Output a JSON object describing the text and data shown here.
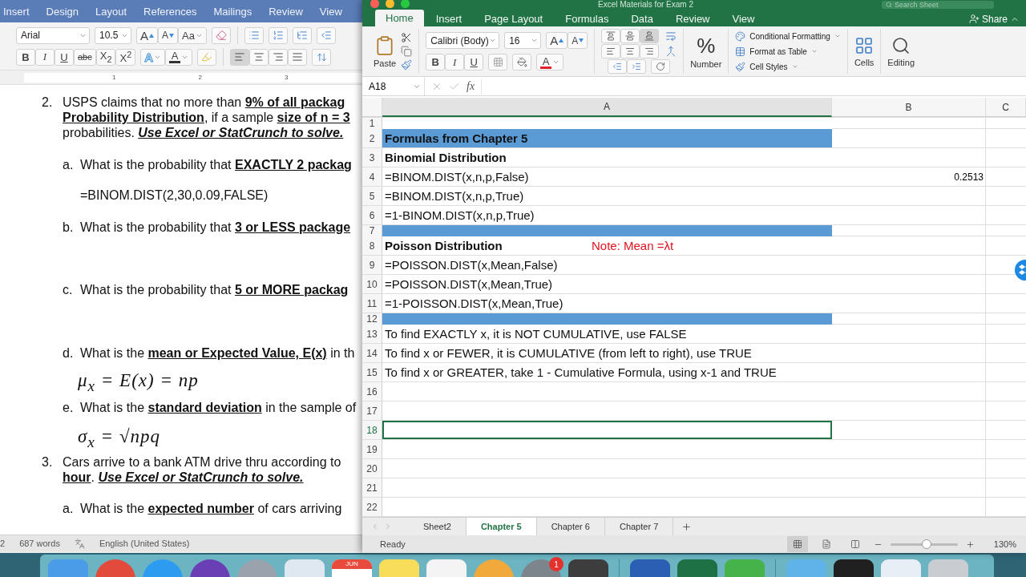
{
  "word": {
    "tabs": [
      "Insert",
      "Design",
      "Layout",
      "References",
      "Mailings",
      "Review",
      "View"
    ],
    "font": "Arial",
    "size": "10.5",
    "font_tools": [
      {
        "label": "A",
        "kind": "grow"
      },
      {
        "label": "A",
        "kind": "shrink"
      },
      {
        "label": "Aa",
        "kind": "case"
      }
    ],
    "format_buttons": [
      {
        "label": "B",
        "kind": "bold"
      },
      {
        "label": "I",
        "kind": "italic"
      },
      {
        "label": "U",
        "kind": "underline"
      },
      {
        "label": "abc",
        "kind": "strike"
      },
      {
        "label": "X$_{2}$",
        "kind": "sub"
      },
      {
        "label": "X$^{2}$",
        "kind": "sup"
      }
    ],
    "effects": [
      {
        "label": "A",
        "kind": "outline"
      },
      {
        "label": "A",
        "kind": "color",
        "color": "#333333"
      }
    ],
    "alignment": [
      {
        "selected": true
      },
      {
        "selected": false
      },
      {
        "selected": false
      },
      {
        "selected": false
      }
    ],
    "ruler_marks": [
      "1",
      "2",
      "3"
    ],
    "paragraphs": [
      {
        "kind": "numbered",
        "label": "2.",
        "lines": [
          [
            {
              "text": "USPS claims that no more than ",
              "kind": "plain"
            },
            {
              "text": "9% of all packag",
              "kind": "bold"
            }
          ],
          [
            {
              "text": "Probability Distribution",
              "kind": "bold"
            },
            {
              "text": ", if a sample ",
              "kind": "plain"
            },
            {
              "text": "size of n = 3",
              "kind": "bold"
            }
          ],
          [
            {
              "text": "probabilities. ",
              "kind": "plain"
            },
            {
              "text": "Use Excel or StatCrunch to solve.",
              "kind": "bolditalic"
            }
          ]
        ]
      },
      {
        "kind": "lettered",
        "label": "a.",
        "lines": [
          [
            {
              "text": "What is the probability that ",
              "kind": "plain"
            },
            {
              "text": "EXACTLY 2 packag",
              "kind": "bold"
            }
          ]
        ]
      },
      {
        "kind": "formula",
        "text": "=BINOM.DIST(2,30,0.09,FALSE)"
      },
      {
        "kind": "lettered",
        "label": "b.",
        "lines": [
          [
            {
              "text": "What is the probability that ",
              "kind": "plain"
            },
            {
              "text": "3 or LESS package",
              "kind": "bold"
            }
          ]
        ]
      },
      {
        "kind": "lettered",
        "label": "c.",
        "lines": [
          [
            {
              "text": "What is the probability that ",
              "kind": "plain"
            },
            {
              "text": "5 or MORE packag",
              "kind": "bold"
            }
          ]
        ]
      },
      {
        "kind": "lettered",
        "label": "d.",
        "lines": [
          [
            {
              "text": "What is the ",
              "kind": "plain"
            },
            {
              "text": "mean or Expected Value, E(x)",
              "kind": "bold"
            },
            {
              "text": " in th",
              "kind": "plain"
            }
          ]
        ]
      },
      {
        "kind": "math",
        "text": "μ$_{x}$ = E(x) = np"
      },
      {
        "kind": "lettered",
        "label": "e.",
        "lines": [
          [
            {
              "text": "What is the ",
              "kind": "plain"
            },
            {
              "text": "standard deviation",
              "kind": "bold"
            },
            {
              "text": " in the sample of",
              "kind": "plain"
            }
          ]
        ]
      },
      {
        "kind": "math",
        "text": "σ$_{x}$ = √npq"
      },
      {
        "kind": "numbered",
        "label": "3.",
        "lines": [
          [
            {
              "text": "Cars arrive to a bank ATM drive thru according to",
              "kind": "plain"
            }
          ],
          [
            {
              "text": "hour",
              "kind": "bold"
            },
            {
              "text": ". ",
              "kind": "plain"
            },
            {
              "text": "Use Excel or StatCrunch to solve.",
              "kind": "bolditalic"
            }
          ]
        ]
      },
      {
        "kind": "lettered",
        "label": "a.",
        "lines": [
          [
            {
              "text": "What is the ",
              "kind": "plain"
            },
            {
              "text": "expected number",
              "kind": "bold"
            },
            {
              "text": " of cars arriving",
              "kind": "plain"
            }
          ]
        ]
      }
    ],
    "status": {
      "page": "2",
      "words": "687 words",
      "language": "English (United States)"
    }
  },
  "excel": {
    "title": "Excel Materials for Exam 2",
    "search": "Search Sheet",
    "tabs": [
      {
        "label": "Home",
        "selected": true
      },
      {
        "label": "Insert",
        "selected": false
      },
      {
        "label": "Page Layout",
        "selected": false
      },
      {
        "label": "Formulas",
        "selected": false
      },
      {
        "label": "Data",
        "selected": false
      },
      {
        "label": "Review",
        "selected": false
      },
      {
        "label": "View",
        "selected": false
      }
    ],
    "share": "Share",
    "ribbon": {
      "paste": "Paste",
      "font": "Calibri (Body)",
      "size": "16",
      "font_tools": [
        {
          "label": "A",
          "kind": "grow"
        },
        {
          "label": "A",
          "kind": "shrink"
        }
      ],
      "format_buttons": [
        {
          "label": "B",
          "kind": "bold"
        },
        {
          "label": "I",
          "kind": "italic"
        },
        {
          "label": "U",
          "kind": "underline"
        }
      ],
      "effects": [
        {
          "label": "A",
          "kind": "color",
          "color": "#e0202a"
        }
      ],
      "valign": [
        {
          "selected": false
        },
        {
          "selected": false
        },
        {
          "selected": true
        }
      ],
      "number_symbol": "%",
      "number": "Number",
      "styles": [
        "Conditional Formatting",
        "Format as Table",
        "Cell Styles"
      ],
      "cells": "Cells",
      "editing": "Editing"
    },
    "name_box": "A18",
    "fx": "fx",
    "columns": [
      {
        "label": "A",
        "selected": true
      },
      {
        "label": "B",
        "selected": false
      },
      {
        "label": "C",
        "selected": false
      }
    ],
    "rows": [
      {
        "number": "1",
        "kind": "short",
        "selected": false
      },
      {
        "number": "2",
        "kind": "header",
        "a": "Formulas from Chapter 5",
        "selected": false
      },
      {
        "number": "3",
        "kind": "bold",
        "a": "Binomial Distribution",
        "selected": false
      },
      {
        "number": "4",
        "kind": "normal",
        "a": "=BINOM.DIST(x,n,p,False)",
        "b": "0.2513",
        "selected": false
      },
      {
        "number": "5",
        "kind": "normal",
        "a": "=BINOM.DIST(x,n,p,True)",
        "selected": false
      },
      {
        "number": "6",
        "kind": "normal",
        "a": "=1-BINOM.DIST(x,n,p,True)",
        "selected": false
      },
      {
        "number": "7",
        "kind": "band",
        "selected": false
      },
      {
        "number": "8",
        "kind": "bold",
        "a": "Poisson Distribution",
        "note": "Note: Mean =λt",
        "selected": false
      },
      {
        "number": "9",
        "kind": "normal",
        "a": "=POISSON.DIST(x,Mean,False)",
        "selected": false
      },
      {
        "number": "10",
        "kind": "normal",
        "a": "=POISSON.DIST(x,Mean,True)",
        "selected": false
      },
      {
        "number": "11",
        "kind": "normal",
        "a": "=1-POISSON.DIST(x,Mean,True)",
        "selected": false
      },
      {
        "number": "12",
        "kind": "band",
        "selected": false
      },
      {
        "number": "13",
        "kind": "normal",
        "a": "To find EXACTLY x, it is NOT CUMULATIVE, use FALSE",
        "selected": false
      },
      {
        "number": "14",
        "kind": "normal",
        "a": "To find x or FEWER, it is CUMULATIVE (from left to right), use TRUE",
        "selected": false
      },
      {
        "number": "15",
        "kind": "normal",
        "a": "To find x or GREATER, take 1 - Cumulative Formula, using x-1 and TRUE",
        "selected": false
      },
      {
        "number": "16",
        "kind": "normal",
        "selected": false
      },
      {
        "number": "17",
        "kind": "normal",
        "selected": false
      },
      {
        "number": "18",
        "kind": "normal",
        "selected": true
      },
      {
        "number": "19",
        "kind": "normal",
        "selected": false
      },
      {
        "number": "20",
        "kind": "normal",
        "selected": false
      },
      {
        "number": "21",
        "kind": "normal",
        "selected": false
      },
      {
        "number": "22",
        "kind": "normal",
        "selected": false
      }
    ],
    "sheets": [
      {
        "label": "Sheet2",
        "selected": false
      },
      {
        "label": "Chapter 5",
        "selected": true
      },
      {
        "label": "Chapter 6",
        "selected": false
      },
      {
        "label": "Chapter 7",
        "selected": false
      }
    ],
    "status": "Ready",
    "zoom": {
      "level": 0.54,
      "reading": "130%"
    }
  },
  "dock": [
    {
      "kind": "square",
      "color": "#4a9be8"
    },
    {
      "kind": "round",
      "color": "#e24b3b"
    },
    {
      "kind": "round",
      "color": "#2d9cf0"
    },
    {
      "kind": "round",
      "color": "#6a3fb5"
    },
    {
      "kind": "round",
      "color": "#9aa3ad"
    },
    {
      "kind": "square",
      "color": "#dfe8f0"
    },
    {
      "kind": "calendar",
      "color": "#ffffff",
      "label": "JUN"
    },
    {
      "kind": "square",
      "color": "#f7dd5a"
    },
    {
      "kind": "square",
      "color": "#f4f4f4"
    },
    {
      "kind": "round",
      "color": "#f2a93b"
    },
    {
      "kind": "round",
      "color": "#7d858c",
      "badge": "1"
    },
    {
      "kind": "square",
      "color": "#3d3d3d"
    },
    {
      "kind": "separator"
    },
    {
      "kind": "square",
      "color": "#2b5fb4"
    },
    {
      "kind": "square",
      "color": "#1e7145"
    },
    {
      "kind": "square",
      "color": "#46b34a"
    },
    {
      "kind": "separator"
    },
    {
      "kind": "square",
      "color": "#5fb3e8"
    },
    {
      "kind": "square",
      "color": "#202020"
    },
    {
      "kind": "square",
      "color": "#e8eef5"
    },
    {
      "kind": "square",
      "color": "#c9cdd1"
    }
  ]
}
